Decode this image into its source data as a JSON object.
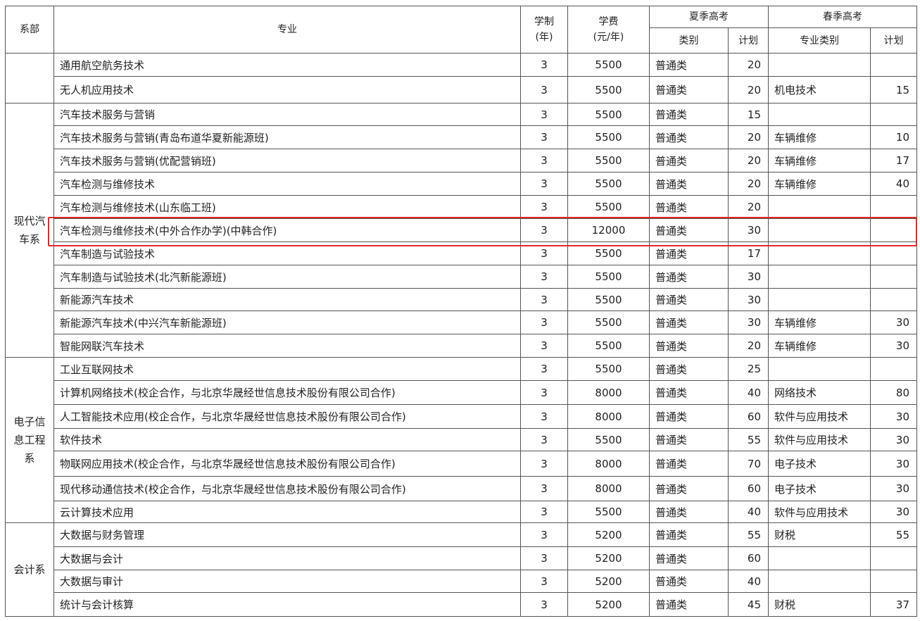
{
  "header": {
    "dept": "系部",
    "major": "专业",
    "years_l1": "学制",
    "years_l2": "(年)",
    "fee_l1": "学费",
    "fee_l2": "(元/年)",
    "summer": "夏季高考",
    "spring": "春季高考",
    "summer_type": "类别",
    "summer_plan": "计划",
    "spring_type": "专业类别",
    "spring_plan": "计划"
  },
  "highlight_color": "#e32626",
  "rows": [
    {
      "major": "通用航空航务技术",
      "years": "3",
      "fee": "5500",
      "stype": "普通类",
      "splan": "20",
      "ptype": "",
      "pplan": ""
    },
    {
      "major": "无人机应用技术",
      "years": "3",
      "fee": "5500",
      "stype": "普通类",
      "splan": "20",
      "ptype": "机电技术",
      "pplan": "15"
    },
    {
      "major": "汽车技术服务与营销",
      "years": "3",
      "fee": "5500",
      "stype": "普通类",
      "splan": "15",
      "ptype": "",
      "pplan": ""
    },
    {
      "major": "汽车技术服务与营销(青岛布道华夏新能源班)",
      "years": "3",
      "fee": "5500",
      "stype": "普通类",
      "splan": "20",
      "ptype": "车辆维修",
      "pplan": "10"
    },
    {
      "major": "汽车技术服务与营销(优配营销班)",
      "years": "3",
      "fee": "5500",
      "stype": "普通类",
      "splan": "20",
      "ptype": "车辆维修",
      "pplan": "17"
    },
    {
      "major": "汽车检测与维修技术",
      "years": "3",
      "fee": "5500",
      "stype": "普通类",
      "splan": "20",
      "ptype": "车辆维修",
      "pplan": "40"
    },
    {
      "major": "汽车检测与维修技术(山东临工班)",
      "years": "3",
      "fee": "5500",
      "stype": "普通类",
      "splan": "20",
      "ptype": "",
      "pplan": ""
    },
    {
      "major": "汽车检测与维修技术(中外合作办学)(中韩合作)",
      "years": "3",
      "fee": "12000",
      "stype": "普通类",
      "splan": "30",
      "ptype": "",
      "pplan": ""
    },
    {
      "major": "汽车制造与试验技术",
      "years": "3",
      "fee": "5500",
      "stype": "普通类",
      "splan": "17",
      "ptype": "",
      "pplan": ""
    },
    {
      "major": "汽车制造与试验技术(北汽新能源班)",
      "years": "3",
      "fee": "5500",
      "stype": "普通类",
      "splan": "30",
      "ptype": "",
      "pplan": ""
    },
    {
      "major": "新能源汽车技术",
      "years": "3",
      "fee": "5500",
      "stype": "普通类",
      "splan": "30",
      "ptype": "",
      "pplan": ""
    },
    {
      "major": "新能源汽车技术(中兴汽车新能源班)",
      "years": "3",
      "fee": "5500",
      "stype": "普通类",
      "splan": "30",
      "ptype": "车辆维修",
      "pplan": "30"
    },
    {
      "major": "智能网联汽车技术",
      "years": "3",
      "fee": "5500",
      "stype": "普通类",
      "splan": "20",
      "ptype": "车辆维修",
      "pplan": "30"
    },
    {
      "major": "工业互联网技术",
      "years": "3",
      "fee": "5500",
      "stype": "普通类",
      "splan": "25",
      "ptype": "",
      "pplan": ""
    },
    {
      "major": "计算机网络技术(校企合作，与北京华晟经世信息技术股份有限公司合作)",
      "years": "3",
      "fee": "8000",
      "stype": "普通类",
      "splan": "40",
      "ptype": "网络技术",
      "pplan": "80"
    },
    {
      "major": "人工智能技术应用(校企合作，与北京华晟经世信息技术股份有限公司合作)",
      "years": "3",
      "fee": "8000",
      "stype": "普通类",
      "splan": "60",
      "ptype": "软件与应用技术",
      "pplan": "30"
    },
    {
      "major": "软件技术",
      "years": "3",
      "fee": "5500",
      "stype": "普通类",
      "splan": "55",
      "ptype": "软件与应用技术",
      "pplan": "30"
    },
    {
      "major": "物联网应用技术(校企合作，与北京华晟经世信息技术股份有限公司合作)",
      "years": "3",
      "fee": "8000",
      "stype": "普通类",
      "splan": "70",
      "ptype": "电子技术",
      "pplan": "30"
    },
    {
      "major": "现代移动通信技术(校企合作，与北京华晟经世信息技术股份有限公司合作)",
      "years": "3",
      "fee": "8000",
      "stype": "普通类",
      "splan": "60",
      "ptype": "电子技术",
      "pplan": "30"
    },
    {
      "major": "云计算技术应用",
      "years": "3",
      "fee": "5500",
      "stype": "普通类",
      "splan": "40",
      "ptype": "软件与应用技术",
      "pplan": "30"
    },
    {
      "major": "大数据与财务管理",
      "years": "3",
      "fee": "5200",
      "stype": "普通类",
      "splan": "55",
      "ptype": "财税",
      "pplan": "55"
    },
    {
      "major": "大数据与会计",
      "years": "3",
      "fee": "5200",
      "stype": "普通类",
      "splan": "60",
      "ptype": "",
      "pplan": ""
    },
    {
      "major": "大数据与审计",
      "years": "3",
      "fee": "5200",
      "stype": "普通类",
      "splan": "40",
      "ptype": "",
      "pplan": ""
    },
    {
      "major": "统计与会计核算",
      "years": "3",
      "fee": "5200",
      "stype": "普通类",
      "splan": "45",
      "ptype": "财税",
      "pplan": "37"
    }
  ],
  "departments": [
    {
      "name": "",
      "rows": 2
    },
    {
      "name": "现代汽车系",
      "rows": 11
    },
    {
      "name": "电子信息工程系",
      "rows": 7
    },
    {
      "name": "会计系",
      "rows": 4
    }
  ]
}
